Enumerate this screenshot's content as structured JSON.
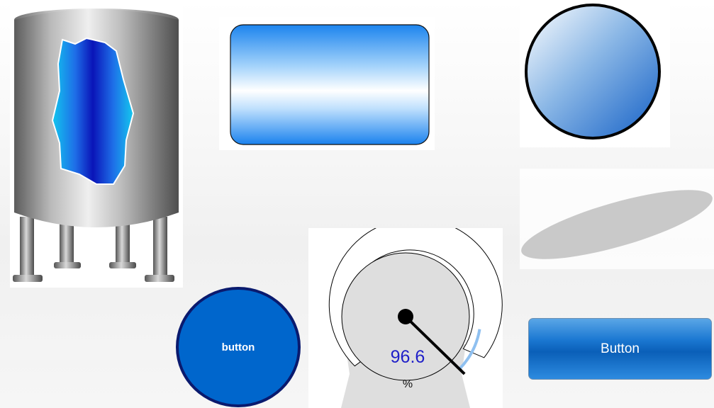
{
  "colors": {
    "tank_body": "#a9a9a9",
    "tank_liquid": "#0a2fc8",
    "tank_liquid_edge": "#12c6ee",
    "accent_blue": "#0066cc",
    "circle_button_border": "#0a1a6e",
    "gauge_face": "#dedede",
    "gauge_value_text": "#1f1fc8",
    "gauge_arc": "#8fc0f0",
    "ellipse_fill": "#c9c9c9"
  },
  "shapes": {
    "tank": "storage-tank-icon",
    "rounded_rect": "gradient-rounded-rectangle",
    "circle": "gradient-circle",
    "ellipse": "tilted-ellipse"
  },
  "circle_button": {
    "label": "button"
  },
  "gauge": {
    "value": "96.6",
    "unit": "%",
    "value_num": 96.6,
    "min": 0,
    "max": 100
  },
  "rect_button": {
    "label": "Button"
  }
}
